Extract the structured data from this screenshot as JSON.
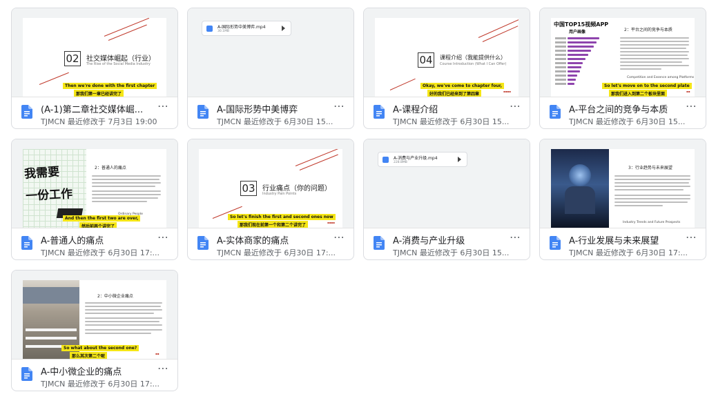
{
  "files": [
    {
      "title": "(A-1)第二章社交媒体崛...",
      "meta": "TJMCN 最近修改于 7月3日 19:00",
      "more": "⋯"
    },
    {
      "title": "A-国际形势中美博弈",
      "meta": "TJMCN 最近修改于 6月30日 15...",
      "more": "⋯"
    },
    {
      "title": "A-课程介绍",
      "meta": "TJMCN 最近修改于 6月30日 15...",
      "more": "⋯"
    },
    {
      "title": "A-平台之间的竞争与本质",
      "meta": "TJMCN 最近修改于 6月30日 15...",
      "more": "⋯"
    },
    {
      "title": "A-普通人的痛点",
      "meta": "TJMCN 最近修改于 6月30日 17:...",
      "more": "⋯"
    },
    {
      "title": "A-实体商家的痛点",
      "meta": "TJMCN 最近修改于 6月30日 17:...",
      "more": "⋯"
    },
    {
      "title": "A-消费与产业升级",
      "meta": "TJMCN 最近修改于 6月30日 15...",
      "more": "⋯"
    },
    {
      "title": "A-行业发展与未来展望",
      "meta": "TJMCN 最近修改于 6月30日 17:...",
      "more": "⋯"
    },
    {
      "title": "A-中小微企业的痛点",
      "meta": "TJMCN 最近修改于 6月30日 17:...",
      "more": "⋯"
    }
  ],
  "thumbs": {
    "t0": {
      "num": "02",
      "heading": "社交媒体崛起（行业）",
      "sub": "The Rise of the Social Media Industry",
      "yellow1": "Then we're done with the first chapter",
      "yellow2": "那我们第一章已经讲完了"
    },
    "t1": {
      "video_name": "A-国际形势中美博弈.mp4",
      "video_size": "30.1MB"
    },
    "t2": {
      "num": "04",
      "heading": "课程介绍（我能提供什么）",
      "sub": "Course Introduction (What I Can Offer)",
      "yellow1": "Okay, we've come to chapter four,",
      "yellow2": "好的我们已经来到了第四章"
    },
    "t3": {
      "chart_title": "中国TOP15视频APP",
      "chart_sub": "用户画像",
      "heading": "2：平台之间的竞争与本质",
      "english": "Competition and Essence among Platforms",
      "yellow1": "So let's move on to the second plate",
      "yellow2": "那我们进入到第二个板块里面"
    },
    "t4": {
      "hand1": "我需要",
      "hand2": "一份工作",
      "heading": "2：普通人的痛点",
      "english": "Ordinary People",
      "yellow1": "And then the first two are over,",
      "yellow2": "然后前两个讲完了"
    },
    "t5": {
      "num": "03",
      "heading": "行业痛点（你的问题）",
      "sub": "Industry Pain Points",
      "yellow1": "So let's finish the first and second ones now",
      "yellow2": "那我们现在前第一个和第二个讲完了"
    },
    "t6": {
      "video_name": "A-消费与产业升级.mp4",
      "video_size": "228.8MB"
    },
    "t7": {
      "heading": "3：行业趋势与未来展望",
      "english": "Industry Trends and Future Prospects"
    },
    "t8": {
      "heading": "2：中小微企业痛点",
      "yellow1": "So what about the second one?",
      "yellow2": "那么其次第二个呢"
    }
  }
}
